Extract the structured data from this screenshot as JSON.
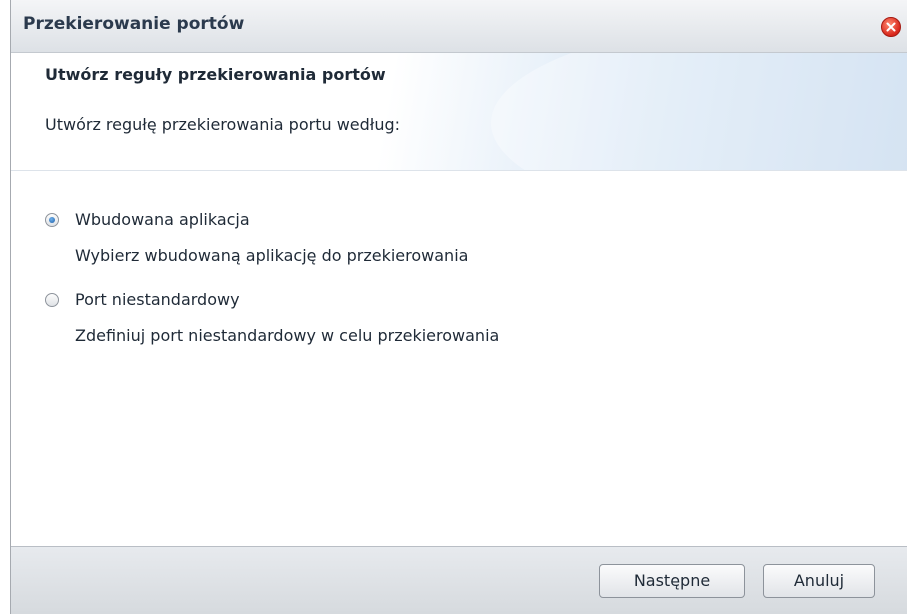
{
  "window": {
    "title": "Przekierowanie portów",
    "close_icon": "close-icon"
  },
  "header": {
    "heading": "Utwórz reguły przekierowania portów",
    "subheading": "Utwórz regułę przekierowania portu według:"
  },
  "options": [
    {
      "label": "Wbudowana aplikacja",
      "description": "Wybierz wbudowaną aplikację do przekierowania",
      "selected": true
    },
    {
      "label": "Port niestandardowy",
      "description": "Zdefiniuj port niestandardowy w celu przekierowania",
      "selected": false
    }
  ],
  "footer": {
    "next_label": "Następne",
    "cancel_label": "Anuluj"
  },
  "colors": {
    "close_button": "#d8261b",
    "radio_selected": "#1e5fa8",
    "header_accent": "#bfd5ec"
  }
}
